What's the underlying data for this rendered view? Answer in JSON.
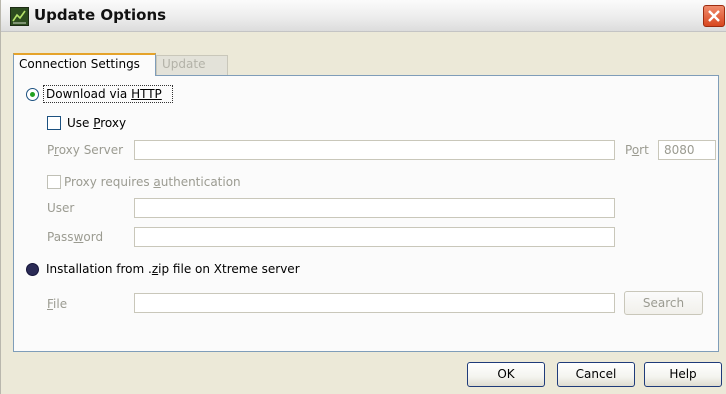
{
  "window": {
    "title": "Update Options"
  },
  "tabs": [
    {
      "label": "Connection Settings",
      "active": true
    },
    {
      "label": "Update",
      "active": false
    }
  ],
  "connection": {
    "radio_http": {
      "label_pre": "Download via ",
      "label_u": "HTTP",
      "selected": true
    },
    "use_proxy": {
      "label_pre": "Use ",
      "label_u": "P",
      "label_post": "roxy",
      "checked": false
    },
    "proxy_server": {
      "label_pre": "P",
      "label_u": "r",
      "label_post": "oxy Server",
      "value": ""
    },
    "port": {
      "label_pre": "P",
      "label_u": "o",
      "label_post": "rt",
      "value": "8080"
    },
    "proxy_auth": {
      "label_pre": "Proxy requires ",
      "label_u": "a",
      "label_post": "uthentication",
      "checked": false
    },
    "user": {
      "label": "User",
      "value": ""
    },
    "password": {
      "label_pre": "Pass",
      "label_u": "w",
      "label_post": "ord",
      "value": ""
    },
    "radio_zip": {
      "label_pre": "Installation from .",
      "label_u": "z",
      "label_post": "ip file on Xtreme server",
      "selected": false
    },
    "file": {
      "label_u": "F",
      "label_post": "ile",
      "value": ""
    },
    "search_label": "Search"
  },
  "buttons": {
    "ok": "OK",
    "cancel": "Cancel",
    "help": "Help"
  }
}
